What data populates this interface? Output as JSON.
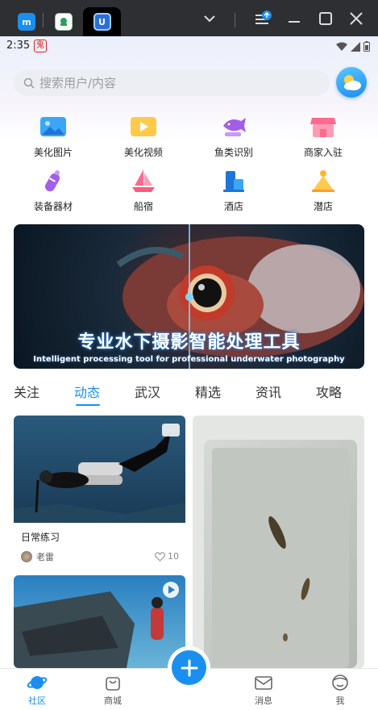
{
  "status": {
    "time": "2:35",
    "badge": "鬼"
  },
  "search": {
    "placeholder": "搜索用户/内容"
  },
  "grid": [
    {
      "label": "美化图片",
      "icon": "picture-icon"
    },
    {
      "label": "美化视频",
      "icon": "video-icon"
    },
    {
      "label": "鱼类识别",
      "icon": "fish-icon"
    },
    {
      "label": "商家入驻",
      "icon": "shop-icon"
    },
    {
      "label": "装备器材",
      "icon": "gear-tank-icon"
    },
    {
      "label": "船宿",
      "icon": "boat-icon"
    },
    {
      "label": "酒店",
      "icon": "hotel-icon"
    },
    {
      "label": "潜店",
      "icon": "dive-shop-icon"
    }
  ],
  "banner": {
    "title": "专业水下摄影智能处理工具",
    "subtitle": "Intelligent processing tool for professional underwater photography"
  },
  "tabs": [
    "关注",
    "动态",
    "武汉",
    "精选",
    "资讯",
    "攻略"
  ],
  "active_tab": "动态",
  "feed": [
    {
      "title": "日常练习",
      "user": "老雷",
      "likes": "10"
    }
  ],
  "nav": [
    {
      "label": "社区",
      "icon": "planet-icon"
    },
    {
      "label": "商城",
      "icon": "bag-icon"
    },
    {
      "label": "消息",
      "icon": "mail-icon"
    },
    {
      "label": "我",
      "icon": "profile-icon"
    }
  ],
  "colors": {
    "accent": "#1a8ff0",
    "titlebar": "#2d2f33"
  }
}
